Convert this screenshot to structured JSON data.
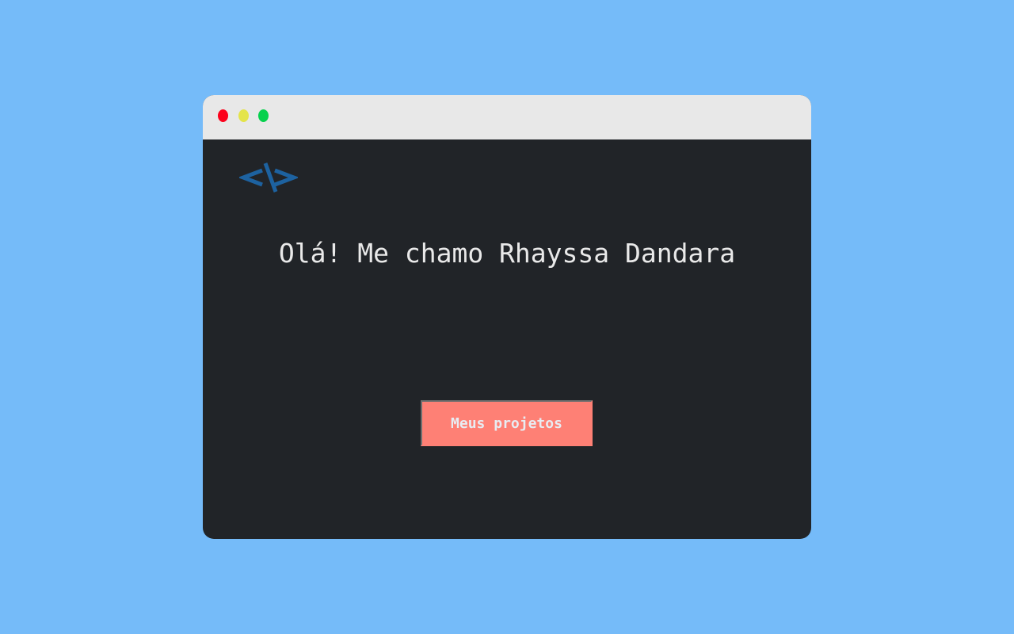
{
  "window": {
    "controls": [
      "close",
      "minimize",
      "maximize"
    ]
  },
  "logo": {
    "icon": "code-brackets-icon",
    "color": "#1d62a0"
  },
  "hero": {
    "headline": "Olá! Me chamo Rhayssa Dandara"
  },
  "actions": {
    "projects_label": "Meus projetos"
  },
  "colors": {
    "background": "#75bbf9",
    "titlebar": "#e8e8e8",
    "window": "#212428",
    "button": "#fe8075",
    "close": "#fc021c",
    "minimize": "#e4e449",
    "maximize": "#06d14d"
  }
}
